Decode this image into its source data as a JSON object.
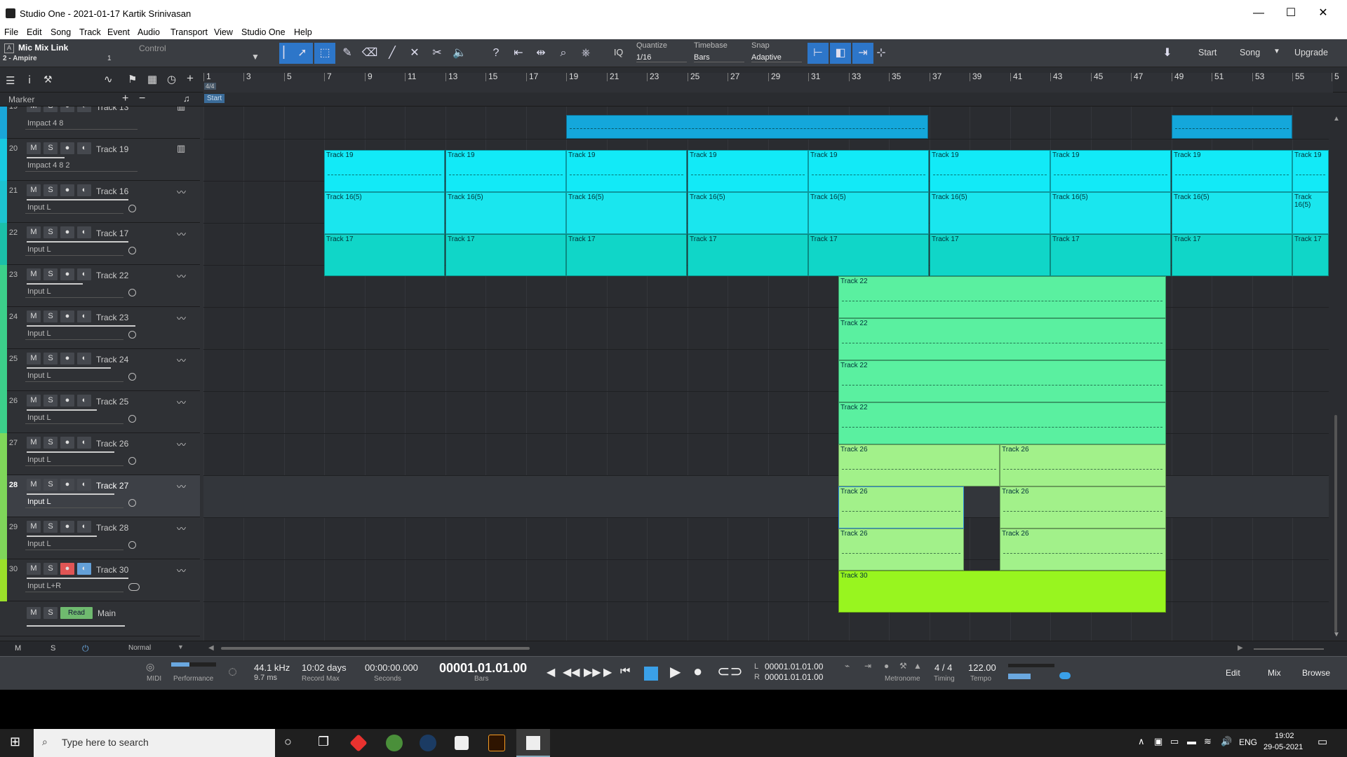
{
  "window": {
    "title": "Studio One - 2021-01-17 Kartik Srinivasan",
    "minimize": "—",
    "maximize": "☐",
    "close": "✕"
  },
  "menu": [
    "File",
    "Edit",
    "Song",
    "Track",
    "Event",
    "Audio",
    "Transport",
    "View",
    "Studio One",
    "Help"
  ],
  "toolbar": {
    "preset_name": "Mic Mix Link",
    "preset_sub": "2 - Ampire",
    "preset_num": "1",
    "control_label": "Control",
    "quantize_label": "Quantize",
    "quantize_value": "1/16",
    "timebase_label": "Timebase",
    "timebase_value": "Bars",
    "snap_label": "Snap",
    "snap_value": "Adaptive",
    "iq_label": "IQ",
    "start": "Start",
    "song": "Song",
    "upgrade": "Upgrade"
  },
  "ruler": {
    "ticks": [
      "1",
      "3",
      "5",
      "7",
      "9",
      "11",
      "13",
      "15",
      "17",
      "19",
      "21",
      "23",
      "25",
      "27",
      "29",
      "31",
      "33",
      "35",
      "37",
      "39",
      "41",
      "43",
      "45",
      "47",
      "49",
      "51",
      "53",
      "55",
      "5"
    ],
    "timesig": "4/4",
    "start_marker": "Start"
  },
  "marker_label": "Marker",
  "tracks": [
    {
      "num": "19",
      "name": "Track 13",
      "input": "Impact 4 8",
      "type": "instrument",
      "color": "#1aa6d8"
    },
    {
      "num": "20",
      "name": "Track 19",
      "input": "Impact 4 8 2",
      "type": "instrument",
      "color": "#19c9e0"
    },
    {
      "num": "21",
      "name": "Track 16",
      "input": "Input L",
      "type": "audio",
      "color": "#1dc3d0"
    },
    {
      "num": "22",
      "name": "Track 17",
      "input": "Input L",
      "type": "audio",
      "color": "#1bbfa8"
    },
    {
      "num": "23",
      "name": "Track 22",
      "input": "Input L",
      "type": "audio",
      "color": "#3ccf8a"
    },
    {
      "num": "24",
      "name": "Track 23",
      "input": "Input L",
      "type": "audio",
      "color": "#3ccf8a"
    },
    {
      "num": "25",
      "name": "Track 24",
      "input": "Input L",
      "type": "audio",
      "color": "#3ccf8a"
    },
    {
      "num": "26",
      "name": "Track 25",
      "input": "Input L",
      "type": "audio",
      "color": "#3ccf8a"
    },
    {
      "num": "27",
      "name": "Track 26",
      "input": "Input L",
      "type": "audio",
      "color": "#7fd65a"
    },
    {
      "num": "28",
      "name": "Track 27",
      "input": "Input L",
      "type": "audio",
      "color": "#7fd65a"
    },
    {
      "num": "29",
      "name": "Track 28",
      "input": "Input L",
      "type": "audio",
      "color": "#7fd65a"
    },
    {
      "num": "30",
      "name": "Track 30",
      "input": "Input L+R",
      "type": "audio",
      "color": "#9be02a"
    }
  ],
  "track_buttons": {
    "mute": "M",
    "solo": "S"
  },
  "main_track": {
    "name": "Main",
    "mode": "Read"
  },
  "bottom_left": {
    "m": "M",
    "s": "S",
    "mode": "Normal"
  },
  "events": {
    "track19": "Track 19",
    "track16": "Track 16(5)",
    "track17": "Track 17",
    "track22": "Track 22",
    "track26": "Track 26",
    "track30": "Track 30"
  },
  "transport": {
    "midi_label": "MIDI",
    "performance_label": "Performance",
    "sample_rate": "44.1 kHz",
    "latency": "9.7 ms",
    "record_max": "10:02 days",
    "record_max_label": "Record Max",
    "seconds": "00:00:00.000",
    "seconds_label": "Seconds",
    "bars": "00001.01.01.00",
    "bars_label": "Bars",
    "loop_l": "00001.01.01.00",
    "loop_r": "00001.01.01.00",
    "l": "L",
    "r": "R",
    "metronome_label": "Metronome",
    "timing": "4 / 4",
    "timing_label": "Timing",
    "tempo": "122.00",
    "tempo_label": "Tempo",
    "edit": "Edit",
    "mix": "Mix",
    "browse": "Browse"
  },
  "taskbar": {
    "search_placeholder": "Type here to search",
    "lang": "ENG",
    "time": "19:02",
    "date": "29-05-2021"
  }
}
